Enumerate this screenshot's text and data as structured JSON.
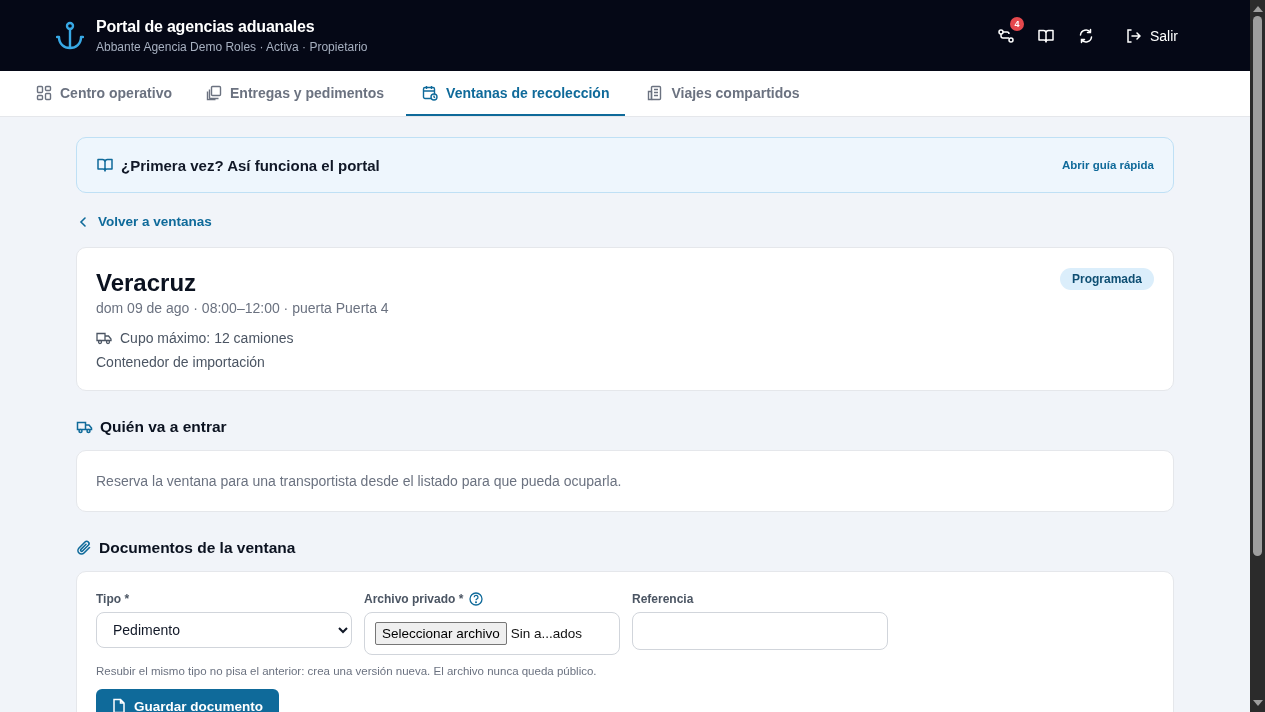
{
  "header": {
    "title": "Portal de agencias aduanales",
    "subtitle": "Abbante Agencia Demo Roles · Activa · Propietario",
    "notifications_badge": "4",
    "logout": "Salir"
  },
  "tabs": [
    {
      "label": "Centro operativo",
      "selected": false
    },
    {
      "label": "Entregas y pedimentos",
      "selected": false
    },
    {
      "label": "Ventanas de recolección",
      "selected": true
    },
    {
      "label": "Viajes compartidos",
      "selected": false
    }
  ],
  "guide_banner": {
    "title": "¿Primera vez? Así funciona el portal",
    "link": "Abrir guía rápida"
  },
  "back_link": "Volver a ventanas",
  "window_card": {
    "title": "Veracruz",
    "schedule": "dom 09 de ago · 08:00–12:00 · puerta Puerta 4",
    "capacity": "Cupo máximo: 12 camiones",
    "cargo": "Contenedor de importación",
    "status": "Programada"
  },
  "who_section": {
    "title": "Quién va a entrar",
    "message": "Reserva la ventana para una transportista desde el listado para que pueda ocuparla."
  },
  "documents_section": {
    "title": "Documentos de la ventana",
    "type_field": {
      "label": "Tipo *",
      "value": "Pedimento"
    },
    "file_field": {
      "label": "Archivo privado *",
      "button": "Seleccionar archivo",
      "file_name": "Sin a...ados"
    },
    "reference_field": {
      "label": "Referencia"
    },
    "hint": "Resubir el mismo tipo no pisa el anterior: crea una versión nueva. El archivo nunca queda público.",
    "save_button": "Guardar documento"
  }
}
